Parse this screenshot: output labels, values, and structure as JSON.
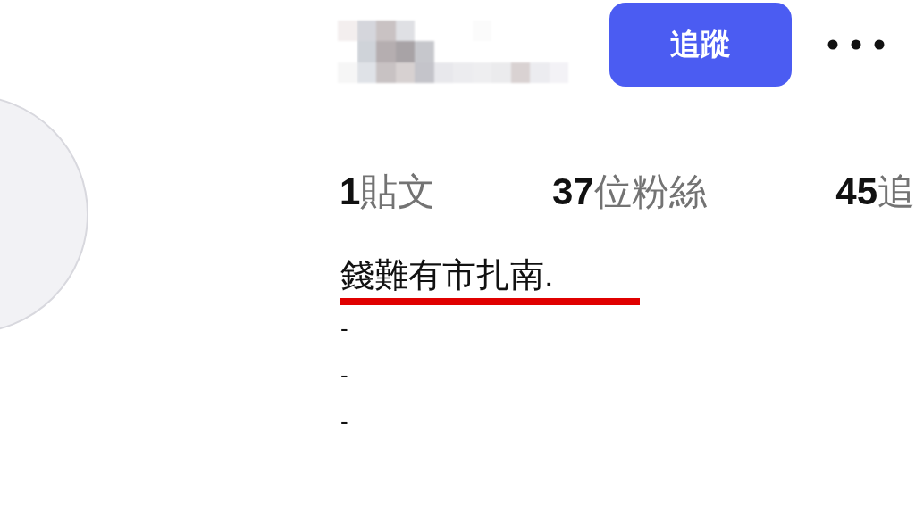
{
  "follow_button": {
    "label": "追蹤"
  },
  "stats": [
    {
      "count": "1",
      "label": "貼文"
    },
    {
      "count": "37",
      "label": "位粉絲"
    },
    {
      "count": "45",
      "label": "追"
    }
  ],
  "bio": {
    "lines": [
      "錢難有市扎南.",
      "-",
      "-",
      "-"
    ]
  }
}
